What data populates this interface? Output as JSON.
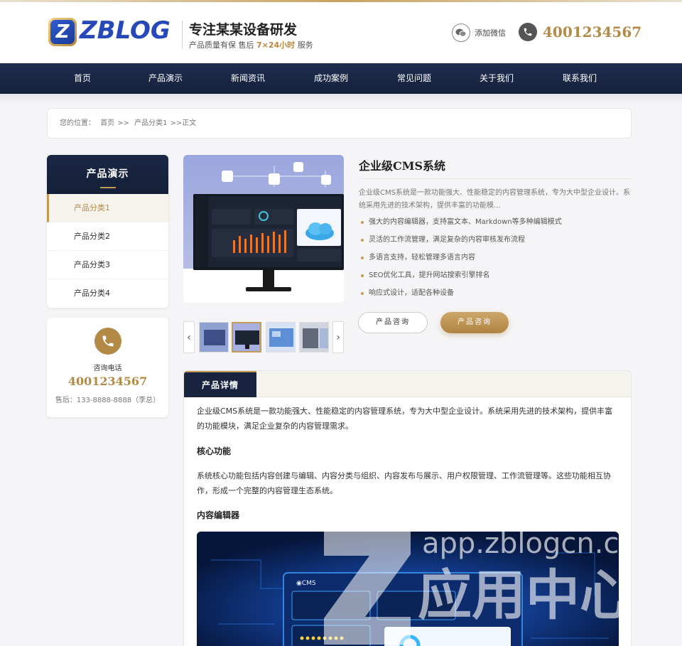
{
  "header": {
    "logo_letter": "Z",
    "logo_text": "ZBLOG",
    "slogan": "专注某某设备研发",
    "sub_slogan_pre": "产品质量有保 售后",
    "sub_slogan_hl": "7×24小时",
    "sub_slogan_post": "服务",
    "wechat_label": "添加微信",
    "phone": "4001234567"
  },
  "nav": {
    "items": [
      "首页",
      "产品演示",
      "新闻资讯",
      "成功案例",
      "常见问题",
      "关于我们",
      "联系我们"
    ]
  },
  "breadcrumb": {
    "prefix": "您的位置：",
    "home": "首页",
    "sep1": ">>",
    "category": "产品分类1",
    "sep2": ">>",
    "current": "正文"
  },
  "sidebar": {
    "title": "产品演示",
    "items": [
      "产品分类1",
      "产品分类2",
      "产品分类3",
      "产品分类4"
    ],
    "active_index": 0,
    "contact_label": "咨询电话",
    "contact_phone": "4001234567",
    "after_sales": "售后：133-8888-8888（李总）"
  },
  "product": {
    "title": "企业级CMS系统",
    "description": "企业级CMS系统是一款功能强大、性能稳定的内容管理系统，专为大中型企业设计。系统采用先进的技术架构，提供丰富的功能模...",
    "features": [
      "强大的内容编辑器，支持富文本、Markdown等多种编辑模式",
      "灵活的工作流管理，满足复杂的内容审核发布流程",
      "多语言支持，轻松管理多语言内容",
      "SEO优化工具，提升网站搜索引擎排名",
      "响应式设计，适配各种设备"
    ],
    "btn_consult_outline": "产品咨询",
    "btn_consult_filled": "产品咨询",
    "gallery_prev": "‹",
    "gallery_next": "›"
  },
  "detail": {
    "tab_label": "产品详情",
    "intro": "企业级CMS系统是一款功能强大、性能稳定的内容管理系统，专为大中型企业设计。系统采用先进的技术架构，提供丰富的功能模块，满足企业复杂的内容管理需求。",
    "section1_title": "核心功能",
    "section1_text": "系统核心功能包括内容创建与编辑、内容分类与组织、内容发布与展示、用户权限管理、工作流管理等。这些功能相互协作，形成一个完整的内容管理生态系统。",
    "section2_title": "内容编辑器"
  },
  "watermark": {
    "url": "app.zblogcn.com",
    "text": "应用中心"
  },
  "colors": {
    "nav_bg": "#18243f",
    "gold": "#b38a45",
    "brand_blue": "#2748b8"
  }
}
